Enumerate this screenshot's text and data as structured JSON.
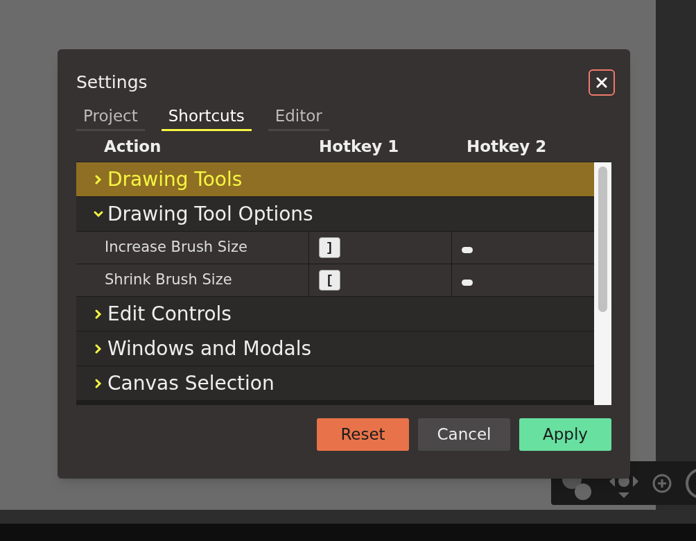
{
  "dialog": {
    "title": "Settings"
  },
  "tabs": [
    {
      "label": "Project",
      "selected": false
    },
    {
      "label": "Shortcuts",
      "selected": true
    },
    {
      "label": "Editor",
      "selected": false
    }
  ],
  "columns": [
    "Action",
    "Hotkey 1",
    "Hotkey 2"
  ],
  "groups": [
    {
      "label": "Drawing Tools",
      "expanded": false,
      "highlighted": true
    },
    {
      "label": "Drawing Tool Options",
      "expanded": true,
      "highlighted": false,
      "children": [
        {
          "action": "Increase Brush Size",
          "hotkeys": [
            {
              "assigned": true,
              "key": "]"
            },
            {
              "assigned": false
            }
          ]
        },
        {
          "action": "Shrink Brush Size",
          "hotkeys": [
            {
              "assigned": true,
              "key": "["
            },
            {
              "assigned": false
            }
          ]
        }
      ]
    },
    {
      "label": "Edit Controls",
      "expanded": false,
      "highlighted": false
    },
    {
      "label": "Windows and Modals",
      "expanded": false,
      "highlighted": false
    },
    {
      "label": "Canvas Selection",
      "expanded": false,
      "highlighted": false
    }
  ],
  "buttons": [
    {
      "label": "Reset",
      "kind": "danger"
    },
    {
      "label": "Cancel",
      "kind": "secondary"
    },
    {
      "label": "Apply",
      "kind": "primary"
    }
  ]
}
